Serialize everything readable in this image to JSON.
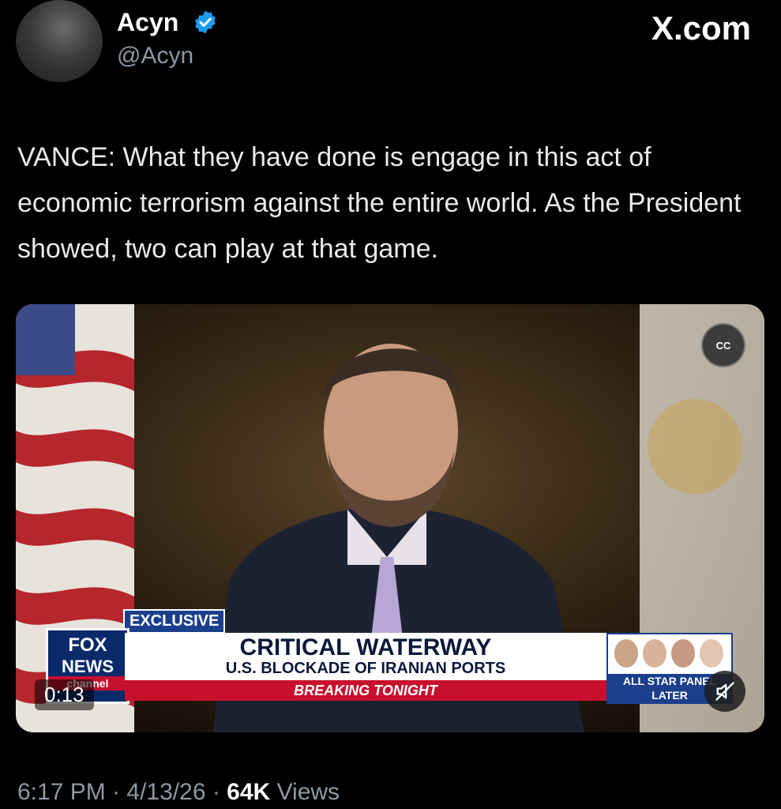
{
  "header": {
    "display_name": "Acyn",
    "handle": "@Acyn",
    "brand": "X.com"
  },
  "tweet": {
    "text": "VANCE: What they have done is engage in this act of economic terrorism against the entire world. As the President showed, two can play at that game."
  },
  "media": {
    "cc_label": "CC",
    "duration": "0:13",
    "lower_third": {
      "tag": "EXCLUSIVE",
      "logo_top": "FOX",
      "logo_mid": "NEWS",
      "logo_bot": "channel",
      "headline": "CRITICAL WATERWAY",
      "subhead": "U.S. BLOCKADE OF IRANIAN PORTS",
      "breaking": "BREAKING TONIGHT",
      "later_line1": "ALL STAR PANEL",
      "later_line2": "LATER"
    }
  },
  "meta": {
    "time": "6:17 PM",
    "date": "4/13/26",
    "views_count": "64K",
    "views_label": "Views"
  },
  "colors": {
    "background": "#000000",
    "verified": "#1d9bf0",
    "muted_text": "#8b98a5",
    "fox_blue": "#1b3f8b",
    "fox_red": "#c8102e"
  }
}
